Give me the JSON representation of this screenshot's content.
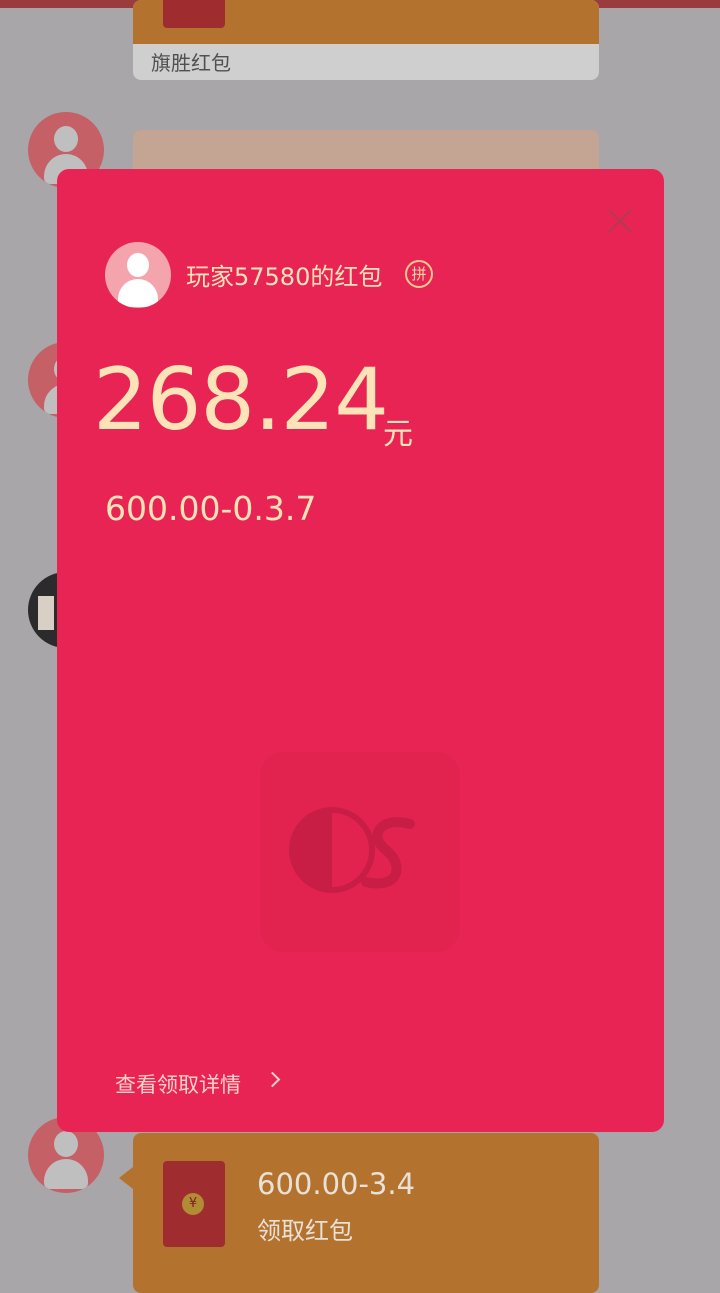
{
  "chat": {
    "card_top_label": "旗胜红包",
    "bottom_card": {
      "amount_text": "600.00-3.4",
      "action_text": "领取红包",
      "coin_symbol": "¥"
    }
  },
  "modal": {
    "sender_title": "玩家57580的红包",
    "pin_badge": "拼",
    "amount": "268.24",
    "unit": "元",
    "remark": "600.00-0.3.7",
    "detail_link": "查看领取详情",
    "close_icon": "close-icon",
    "colors": {
      "background": "#e82455",
      "gold_text": "#fde3b8"
    }
  }
}
